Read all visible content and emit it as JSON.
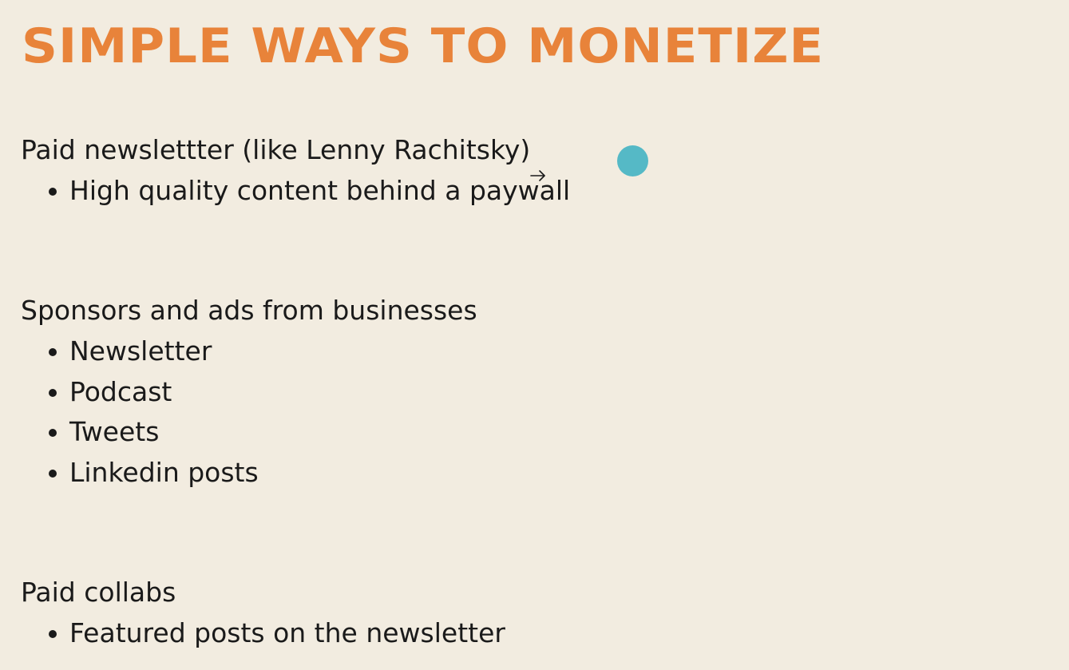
{
  "slide": {
    "title": "SIMPLE WAYS TO MONETIZE",
    "accent_color": "#e8833a",
    "background_color": "#f2ece0",
    "sections": [
      {
        "heading": "Paid newslettter (like Lenny Rachitsky)",
        "bullets": [
          "High quality content behind a paywall"
        ]
      },
      {
        "heading": "Sponsors and ads from businesses",
        "bullets": [
          "Newsletter",
          "Podcast",
          "Tweets",
          "Linkedin posts"
        ]
      },
      {
        "heading": "Paid collabs",
        "bullets": [
          "Featured posts on the newsletter"
        ]
      }
    ]
  },
  "overlay": {
    "pointer_indicator_color": "#55b9c6",
    "cursor_icon": "arrow-right-icon"
  }
}
